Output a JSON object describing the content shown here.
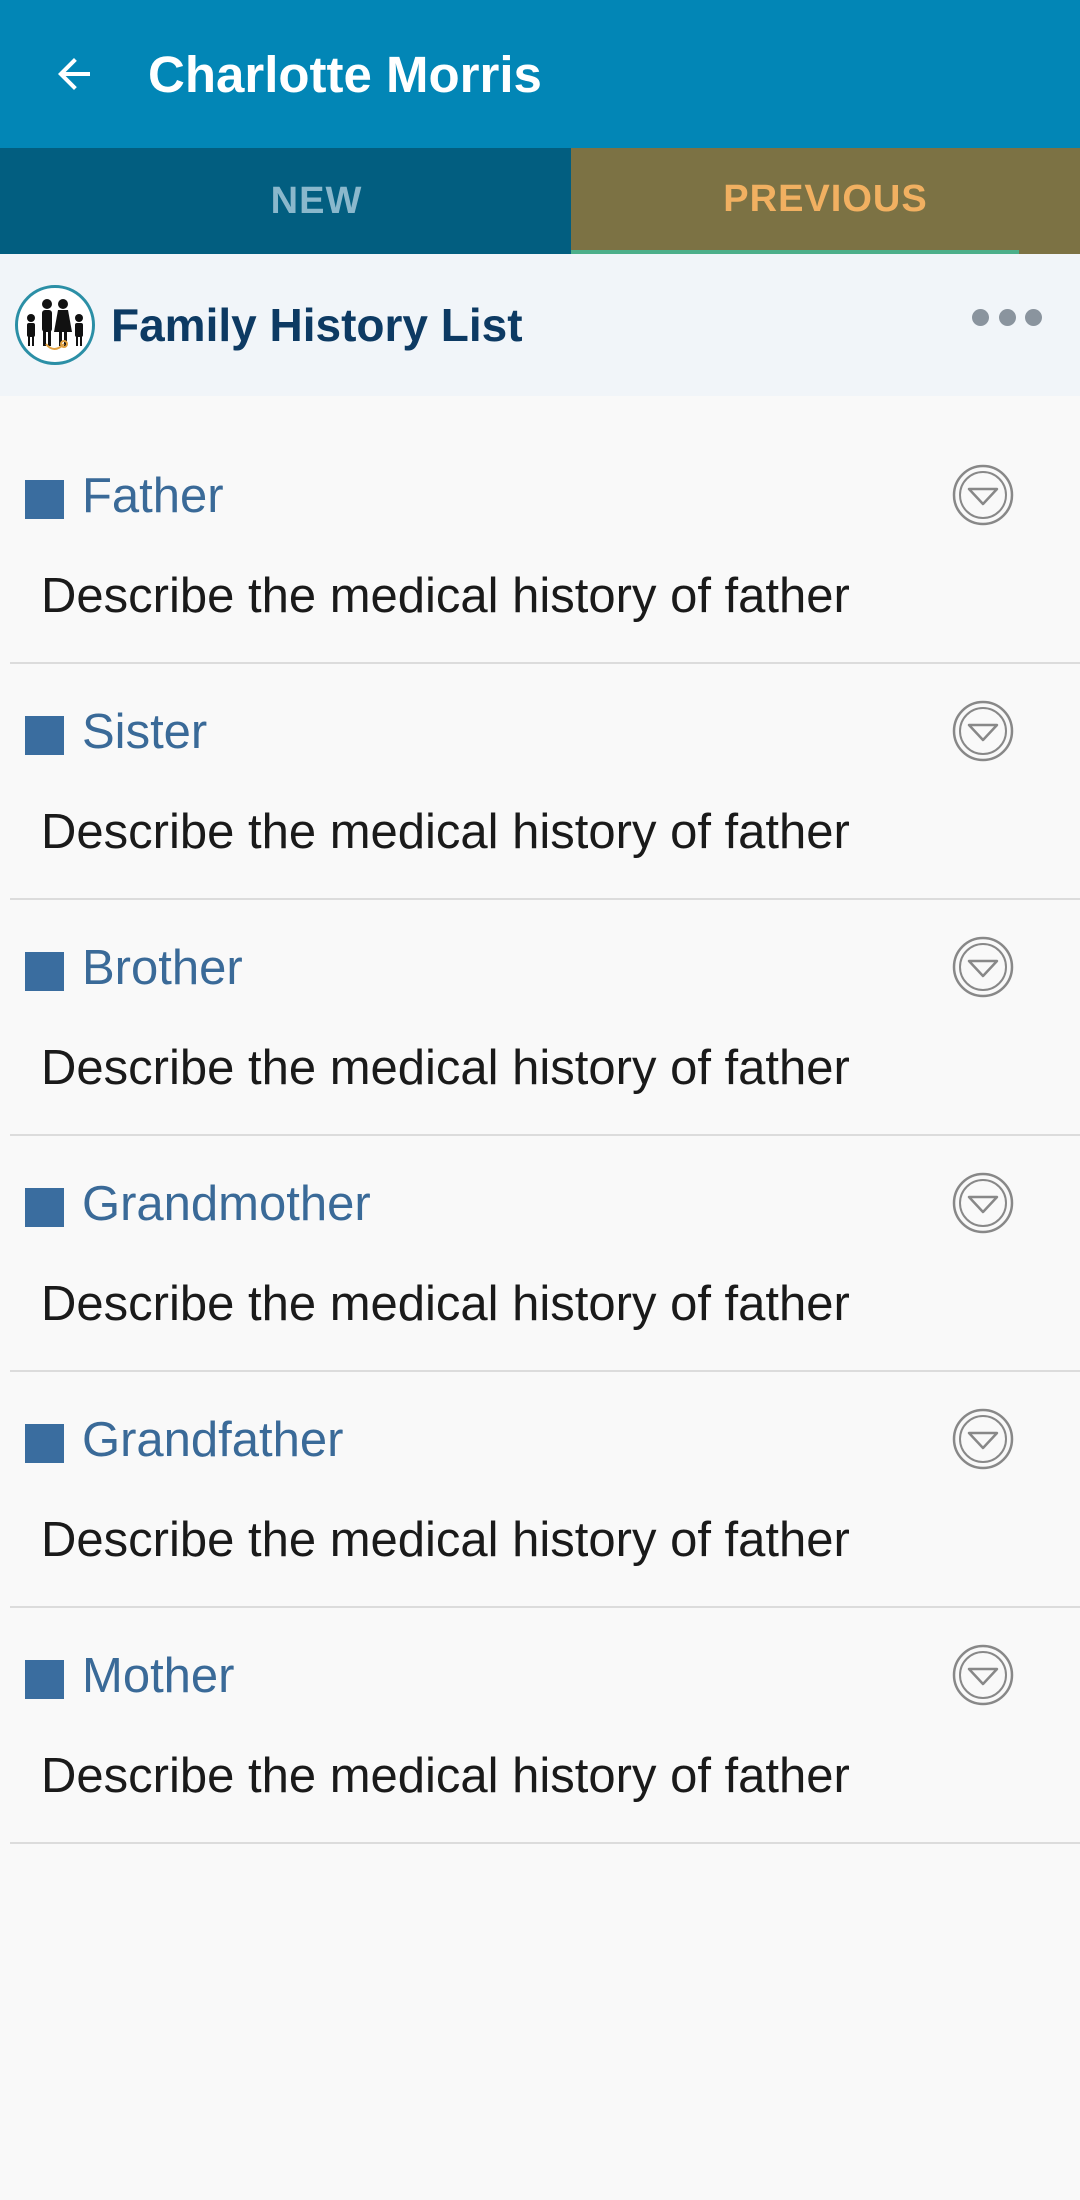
{
  "appbar": {
    "title": "Charlotte Morris",
    "back_icon": "arrow-left-icon",
    "color": "#0286b6"
  },
  "tabs": [
    {
      "label": "NEW",
      "active": false
    },
    {
      "label": "PREVIOUS",
      "active": true
    }
  ],
  "section": {
    "title": "Family History List",
    "logo_icon": "family-icon",
    "more_icon": "more-horizontal-icon"
  },
  "items": [
    {
      "title": "Father",
      "description": "Describe the medical history of father"
    },
    {
      "title": "Sister",
      "description": "Describe the medical history of father"
    },
    {
      "title": "Brother",
      "description": "Describe the medical history of father"
    },
    {
      "title": "Grandmother",
      "description": "Describe the medical history of father"
    },
    {
      "title": "Grandfather",
      "description": "Describe the medical history of father"
    },
    {
      "title": "Mother",
      "description": "Describe the medical history of father"
    }
  ],
  "colors": {
    "accent": "#0286b6",
    "tab_inactive_bg": "#025e80",
    "tab_active_bg": "#7c7244",
    "tab_active_text": "#f1b061",
    "item_title": "#3a6a98",
    "item_marker": "#3a6d9f"
  }
}
